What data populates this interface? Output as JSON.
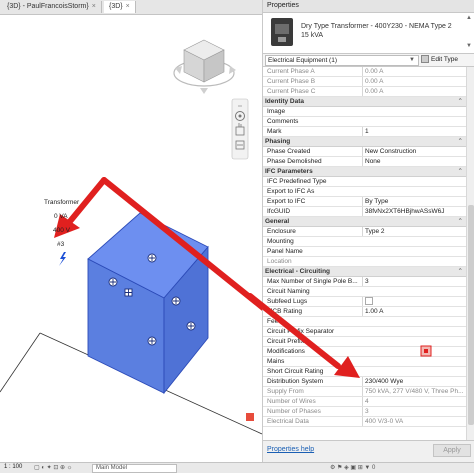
{
  "viewport": {
    "tabs": [
      {
        "label": "{3D} - PaulFrancoisStorm}",
        "close": "×"
      },
      {
        "label": "{3D}",
        "close": "×"
      }
    ],
    "labels": {
      "name": "Transformer",
      "va": "0 VA",
      "voltage": "400 V",
      "number": "#3"
    },
    "viewcube_faces": {
      "top": "TOP",
      "front": "FRONT",
      "right": "RIGHT"
    },
    "status": {
      "scale": "1 : 100",
      "model": "Main Model"
    }
  },
  "properties": {
    "title": "Properties",
    "type_name": "Dry Type Transformer - 400Y230 - NEMA Type 2 15 kVA",
    "filter": "Electrical Equipment (1)",
    "edit_type": "Edit Type",
    "groups": [
      {
        "name": "",
        "rows": [
          {
            "label": "Current Phase A",
            "value": "0.00 A",
            "gray": true
          },
          {
            "label": "Current Phase B",
            "value": "0.00 A",
            "gray": true
          },
          {
            "label": "Current Phase C",
            "value": "0.00 A",
            "gray": true
          }
        ]
      },
      {
        "name": "Identity Data",
        "rows": [
          {
            "label": "Image",
            "value": ""
          },
          {
            "label": "Comments",
            "value": ""
          },
          {
            "label": "Mark",
            "value": "1"
          }
        ]
      },
      {
        "name": "Phasing",
        "rows": [
          {
            "label": "Phase Created",
            "value": "New Construction"
          },
          {
            "label": "Phase Demolished",
            "value": "None"
          }
        ]
      },
      {
        "name": "IFC Parameters",
        "rows": [
          {
            "label": "IFC Predefined Type",
            "value": ""
          },
          {
            "label": "Export to IFC As",
            "value": ""
          },
          {
            "label": "Export to IFC",
            "value": "By Type"
          },
          {
            "label": "IfcGUID",
            "value": "38fvNx2XT6HBjhwASsW6J"
          }
        ]
      },
      {
        "name": "General",
        "rows": [
          {
            "label": "Enclosure",
            "value": "Type 2"
          },
          {
            "label": "Mounting",
            "value": ""
          },
          {
            "label": "Panel Name",
            "value": ""
          },
          {
            "label": "Location",
            "value": "",
            "gray": true
          }
        ]
      },
      {
        "name": "Electrical - Circuiting",
        "rows": [
          {
            "label": "Max Number of Single Pole B...",
            "value": "3"
          },
          {
            "label": "Circuit Naming",
            "value": ""
          },
          {
            "label": "Subfeed Lugs",
            "value": ""
          },
          {
            "label": "MCB Rating",
            "value": "1.00 A"
          },
          {
            "label": "Feed",
            "value": ""
          },
          {
            "label": "Circuit Prefix Separator",
            "value": ""
          },
          {
            "label": "Circuit Prefix",
            "value": ""
          },
          {
            "label": "Modifications",
            "value": ""
          },
          {
            "label": "Mains",
            "value": ""
          },
          {
            "label": "Short Circuit Rating",
            "value": ""
          },
          {
            "label": "Distribution System",
            "value": "230/400 Wye"
          },
          {
            "label": "Supply From",
            "value": "750 kVA, 277 V/480 V, Three Ph...",
            "gray": true
          },
          {
            "label": "Number of Wires",
            "value": "4",
            "gray": true
          },
          {
            "label": "Number of Phases",
            "value": "3",
            "gray": true
          },
          {
            "label": "Electrical Data",
            "value": "400 V/3-0 VA",
            "gray": true
          }
        ]
      }
    ],
    "help": "Properties help",
    "apply": "Apply"
  },
  "colors": {
    "box_face": "#5b7fe0",
    "arrow": "#e0201f",
    "accent": "#1a5fb4"
  }
}
